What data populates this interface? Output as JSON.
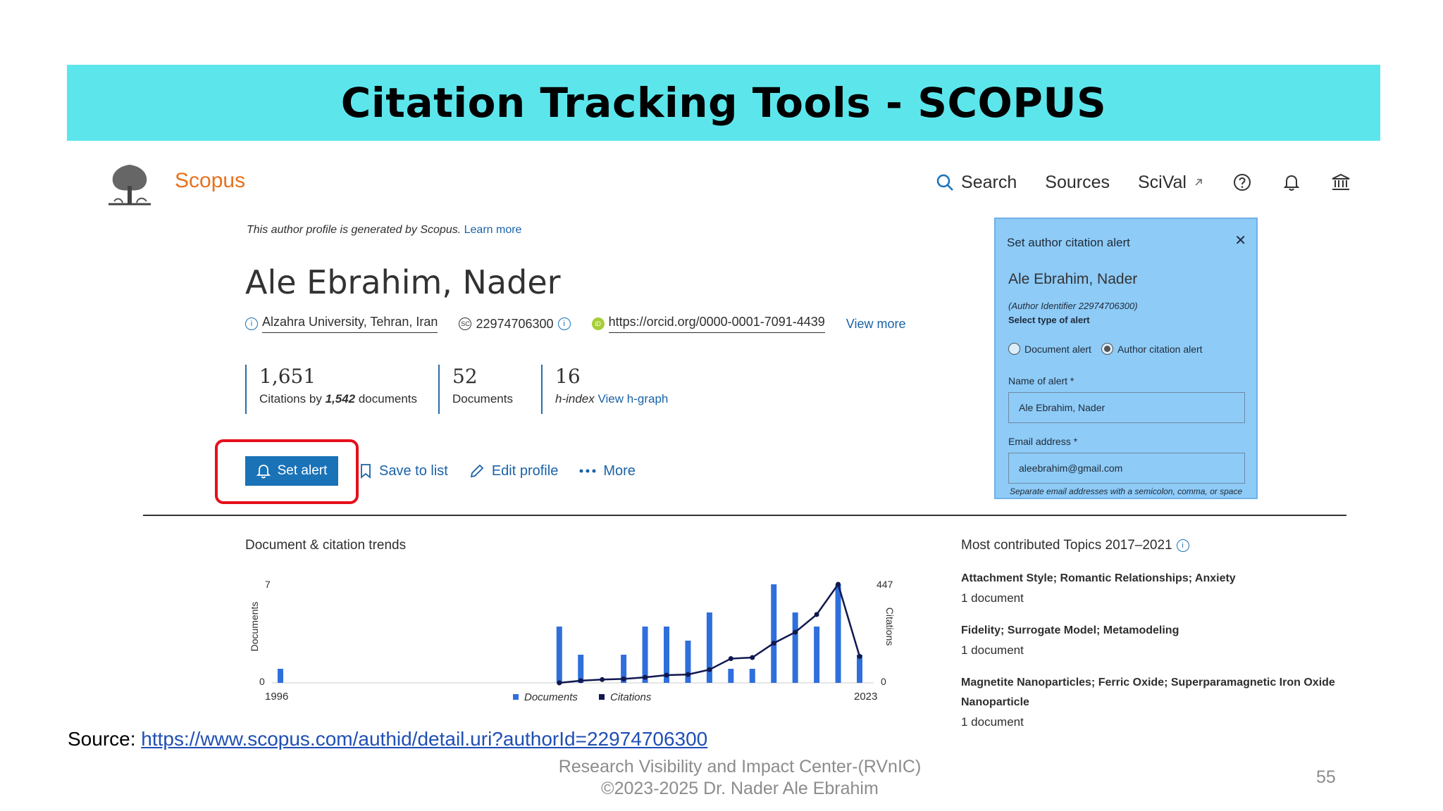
{
  "slide": {
    "title": "Citation Tracking Tools - SCOPUS",
    "source_label": "Source:",
    "source_url": "https://www.scopus.com/authid/detail.uri?authorId=22974706300",
    "footer_line1": "Research Visibility and Impact Center-(RVnIC)",
    "footer_line2": "©2023-2025 Dr. Nader Ale Ebrahim",
    "page_number": "55"
  },
  "header": {
    "brand": "Scopus",
    "nav": {
      "search": "Search",
      "sources": "Sources",
      "scival": "SciVal"
    }
  },
  "profile": {
    "note": "This author profile is generated by Scopus.",
    "learn_more": "Learn more",
    "name": "Ale Ebrahim, Nader",
    "affiliation": "Alzahra University, Tehran, Iran",
    "scopus_id": "22974706300",
    "orcid": "https://orcid.org/0000-0001-7091-4439",
    "view_more": "View more",
    "metrics": {
      "citations": "1,651",
      "citations_label_pre": "Citations by",
      "citations_docs": "1,542",
      "citations_label_post": "documents",
      "documents": "52",
      "documents_label": "Documents",
      "hindex": "16",
      "hindex_label": "h-index",
      "hgraph_link": "View h-graph"
    },
    "actions": {
      "set_alert": "Set alert",
      "save_to_list": "Save to list",
      "edit_profile": "Edit profile",
      "more": "More"
    }
  },
  "alert_panel": {
    "title": "Set author citation alert",
    "author": "Ale Ebrahim, Nader",
    "identifier": "(Author Identifier 22974706300)",
    "type_label": "Select type of alert",
    "option_document": "Document alert",
    "option_author": "Author citation alert",
    "selected": "Author citation alert",
    "name_label": "Name of alert *",
    "name_value": "Ale Ebrahim, Nader",
    "email_label": "Email address *",
    "email_value": "aleebrahim@gmail.com",
    "hint": "Separate email addresses with a semicolon, comma, or space"
  },
  "chart_data": {
    "type": "bar",
    "title": "Document & citation trends",
    "xlabel": "",
    "ylabel": "Documents",
    "y2label": "Citations",
    "x_start_label": "1996",
    "x_end_label": "2023",
    "x": [
      1996,
      2009,
      2010,
      2011,
      2012,
      2013,
      2014,
      2015,
      2016,
      2017,
      2018,
      2019,
      2020,
      2021,
      2022,
      2023
    ],
    "ylim": [
      0,
      7
    ],
    "y2lim": [
      0,
      447
    ],
    "y_ticks": [
      "0",
      "7"
    ],
    "y2_ticks": [
      "0",
      "447"
    ],
    "series": [
      {
        "name": "Documents",
        "kind": "bar",
        "color": "#2f6fdc",
        "values": [
          1,
          4,
          2,
          0,
          2,
          4,
          4,
          3,
          5,
          1,
          1,
          7,
          5,
          4,
          7,
          2
        ]
      },
      {
        "name": "Citations",
        "kind": "line",
        "color": "#101850",
        "values": [
          null,
          0,
          10,
          15,
          18,
          25,
          35,
          38,
          60,
          110,
          115,
          180,
          230,
          310,
          447,
          120
        ]
      }
    ],
    "legend_position": "bottom"
  },
  "topics": {
    "title": "Most contributed Topics 2017–2021",
    "items": [
      {
        "name": "Attachment Style; Romantic Relationships; Anxiety",
        "count": "1 document"
      },
      {
        "name": "Fidelity; Surrogate Model; Metamodeling",
        "count": "1 document"
      },
      {
        "name": "Magnetite Nanoparticles; Ferric Oxide; Superparamagnetic Iron Oxide Nanoparticle",
        "count": "1 document"
      }
    ]
  },
  "colors": {
    "title_band": "#5ce6ec",
    "brand": "#e9711c",
    "primary": "#1a72b7",
    "link": "#1a62a8",
    "highlight": "#e5101b",
    "panel": "#8ecbf7"
  }
}
